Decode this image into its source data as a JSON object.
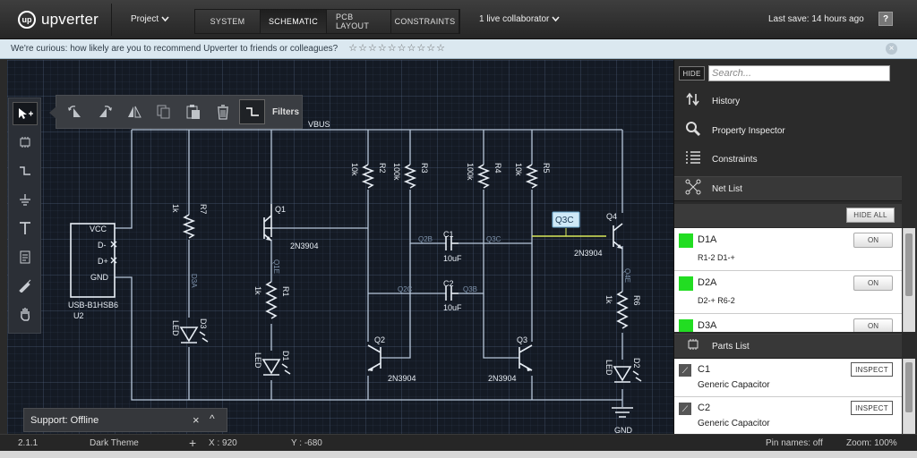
{
  "app": {
    "logo_mark": "up",
    "logo_text": "upverter"
  },
  "header": {
    "project_label": "Project",
    "tabs": [
      {
        "label": "SYSTEM",
        "active": false
      },
      {
        "label": "SCHEMATIC",
        "active": true
      },
      {
        "label": "PCB LAYOUT",
        "active": false
      },
      {
        "label": "CONSTRAINTS",
        "active": false
      }
    ],
    "collaborators": "1 live collaborator",
    "last_save": "Last save: 14 hours ago",
    "help_label": "?"
  },
  "survey": {
    "question": "We're curious:  how likely are you to recommend Upverter to friends or colleagues?",
    "stars": 10,
    "close_label": "×"
  },
  "toolbar": {
    "filters_label": "Filters",
    "icons": [
      "rotate-left-icon",
      "rotate-right-icon",
      "flip-icon",
      "copy-icon",
      "paste-icon",
      "trash-icon",
      "wire-icon"
    ]
  },
  "tool_palette": [
    "select-tool-icon",
    "chip-tool-icon",
    "wire-tool-icon",
    "ground-tool-icon",
    "text-tool-icon",
    "note-tool-icon",
    "probe-tool-icon",
    "pan-tool-icon"
  ],
  "schematic": {
    "net_vbus": "VBUS",
    "connector": {
      "pins": [
        "VCC",
        "D-",
        "D+",
        "GND"
      ],
      "part": "USB-B1HSB6",
      "ref": "U2"
    },
    "resistors": [
      {
        "ref": "R7",
        "value": "1k"
      },
      {
        "ref": "R1",
        "value": "1k"
      },
      {
        "ref": "R2",
        "value": "10k"
      },
      {
        "ref": "R3",
        "value": "100k"
      },
      {
        "ref": "R4",
        "value": "100k"
      },
      {
        "ref": "R5",
        "value": "10k"
      },
      {
        "ref": "R6",
        "value": "1k"
      }
    ],
    "transistors": [
      {
        "ref": "Q1",
        "part": "2N3904"
      },
      {
        "ref": "Q2",
        "part": "2N3904"
      },
      {
        "ref": "Q3",
        "part": "2N3904"
      },
      {
        "ref": "Q4",
        "part": "2N3904"
      }
    ],
    "capacitors": [
      {
        "ref": "C1",
        "value": "10uF"
      },
      {
        "ref": "C2",
        "value": "10uF"
      }
    ],
    "leds": [
      {
        "ref": "D3",
        "label": "LED"
      },
      {
        "ref": "D1",
        "label": "LED"
      },
      {
        "ref": "D2",
        "label": "LED"
      }
    ],
    "nets": {
      "d3a": "D3A",
      "q1e": "Q1E",
      "q2b": "Q2B",
      "q3c": "Q3C",
      "q2c": "Q2C",
      "q3b": "Q3B",
      "q4e": "Q4E"
    },
    "hover_label": "Q3C",
    "gnd_label": "GND"
  },
  "support": {
    "label": "Support: Offline",
    "close_label": "×",
    "min_label": "^"
  },
  "status": {
    "version": "2.1.1",
    "theme": "Dark Theme",
    "x": "X : 920",
    "y": "Y : -680",
    "pin_names": "Pin names: off",
    "zoom": "Zoom: 100%"
  },
  "panel": {
    "hide_label": "HIDE",
    "search_placeholder": "Search...",
    "nav": [
      {
        "label": "History",
        "icon": "history-icon"
      },
      {
        "label": "Property Inspector",
        "icon": "magnifier-icon"
      },
      {
        "label": "Constraints",
        "icon": "list-icon"
      }
    ],
    "net_list_title": "Net List",
    "hide_all_label": "HIDE ALL",
    "nets": [
      {
        "name": "D1A",
        "connections": "R1-2  D1-+",
        "toggle": "ON",
        "color": "#22dd22"
      },
      {
        "name": "D2A",
        "connections": "D2-+  R6-2",
        "toggle": "ON",
        "color": "#22dd22"
      },
      {
        "name": "D3A",
        "connections": "",
        "toggle": "ON",
        "color": "#22dd22"
      }
    ],
    "parts_list_title": "Parts List",
    "parts": [
      {
        "name": "C1",
        "description": "Generic Capacitor",
        "action": "INSPECT"
      },
      {
        "name": "C2",
        "description": "Generic Capacitor",
        "action": "INSPECT"
      }
    ]
  },
  "colors": {
    "wire": "#b7c7d9",
    "highlight": "#d8e85a",
    "accent_green": "#22dd22",
    "canvas_bg": "#141a24"
  }
}
